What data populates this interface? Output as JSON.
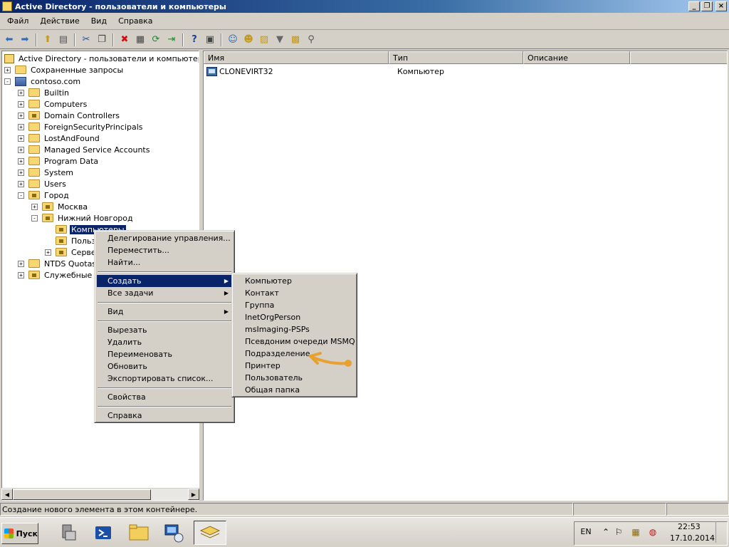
{
  "window": {
    "title": "Active Directory - пользователи и компьютеры",
    "buttons": {
      "minimize": "_",
      "restore": "❐",
      "close": "×"
    }
  },
  "menubar": [
    "Файл",
    "Действие",
    "Вид",
    "Справка"
  ],
  "toolbar_icons": [
    "back-arrow-icon",
    "forward-arrow-icon",
    "up-folder-icon",
    "show-console-tree-icon",
    "cut-icon",
    "copy-icon",
    "delete-icon",
    "properties-icon",
    "refresh-icon",
    "export-list-icon",
    "help-icon",
    "mmc-view-icon",
    "new-user-icon",
    "new-group-icon",
    "new-ou-icon",
    "filter-icon",
    "add-to-group-icon",
    "find-icon"
  ],
  "tree": {
    "root": "Active Directory - пользователи и компьютеры [dc",
    "items": [
      {
        "label": "Сохраненные запросы",
        "level": 1,
        "expander": "+",
        "icon": "folder"
      },
      {
        "label": "contoso.com",
        "level": 1,
        "expander": "-",
        "icon": "domain"
      },
      {
        "label": "Builtin",
        "level": 2,
        "expander": "+",
        "icon": "folder"
      },
      {
        "label": "Computers",
        "level": 2,
        "expander": "+",
        "icon": "folder"
      },
      {
        "label": "Domain Controllers",
        "level": 2,
        "expander": "+",
        "icon": "ou"
      },
      {
        "label": "ForeignSecurityPrincipals",
        "level": 2,
        "expander": "+",
        "icon": "folder"
      },
      {
        "label": "LostAndFound",
        "level": 2,
        "expander": "+",
        "icon": "folder"
      },
      {
        "label": "Managed Service Accounts",
        "level": 2,
        "expander": "+",
        "icon": "folder"
      },
      {
        "label": "Program Data",
        "level": 2,
        "expander": "+",
        "icon": "folder"
      },
      {
        "label": "System",
        "level": 2,
        "expander": "+",
        "icon": "folder"
      },
      {
        "label": "Users",
        "level": 2,
        "expander": "+",
        "icon": "folder"
      },
      {
        "label": "Город",
        "level": 2,
        "expander": "-",
        "icon": "ou"
      },
      {
        "label": "Москва",
        "level": 3,
        "expander": "+",
        "icon": "ou"
      },
      {
        "label": "Нижний Новгород",
        "level": 3,
        "expander": "-",
        "icon": "ou"
      },
      {
        "label": "Компьютеры",
        "level": 4,
        "expander": "",
        "icon": "ou",
        "selected": true
      },
      {
        "label": "Польз",
        "level": 4,
        "expander": "",
        "icon": "ou"
      },
      {
        "label": "Серве",
        "level": 4,
        "expander": "+",
        "icon": "ou"
      },
      {
        "label": "NTDS Quotas",
        "level": 2,
        "expander": "+",
        "icon": "folder"
      },
      {
        "label": "Служебные",
        "level": 2,
        "expander": "+",
        "icon": "ou"
      }
    ]
  },
  "list": {
    "columns": [
      "Имя",
      "Тип",
      "Описание"
    ],
    "rows": [
      {
        "name": "CLONEVIRT32",
        "type": "Компьютер",
        "description": ""
      }
    ]
  },
  "context_menu": {
    "items": [
      "Делегирование управления...",
      "Переместить...",
      "Найти...",
      "Создать",
      "Все задачи",
      "Вид",
      "Вырезать",
      "Удалить",
      "Переименовать",
      "Обновить",
      "Экспортировать список...",
      "Свойства",
      "Справка"
    ]
  },
  "submenu_create": {
    "items": [
      "Компьютер",
      "Контакт",
      "Группа",
      "InetOrgPerson",
      "msImaging-PSPs",
      "Псевдоним очереди MSMQ",
      "Подразделение",
      "Принтер",
      "Пользователь",
      "Общая папка"
    ]
  },
  "status": {
    "text": "Создание нового элемента в этом контейнере."
  },
  "taskbar": {
    "start_label": "Пуск",
    "language": "EN",
    "time": "22:53",
    "date": "17.10.2014"
  },
  "colors": {
    "selection": "#0a246a",
    "annotation_arrow": "#e8a030",
    "face": "#d4d0c8"
  }
}
